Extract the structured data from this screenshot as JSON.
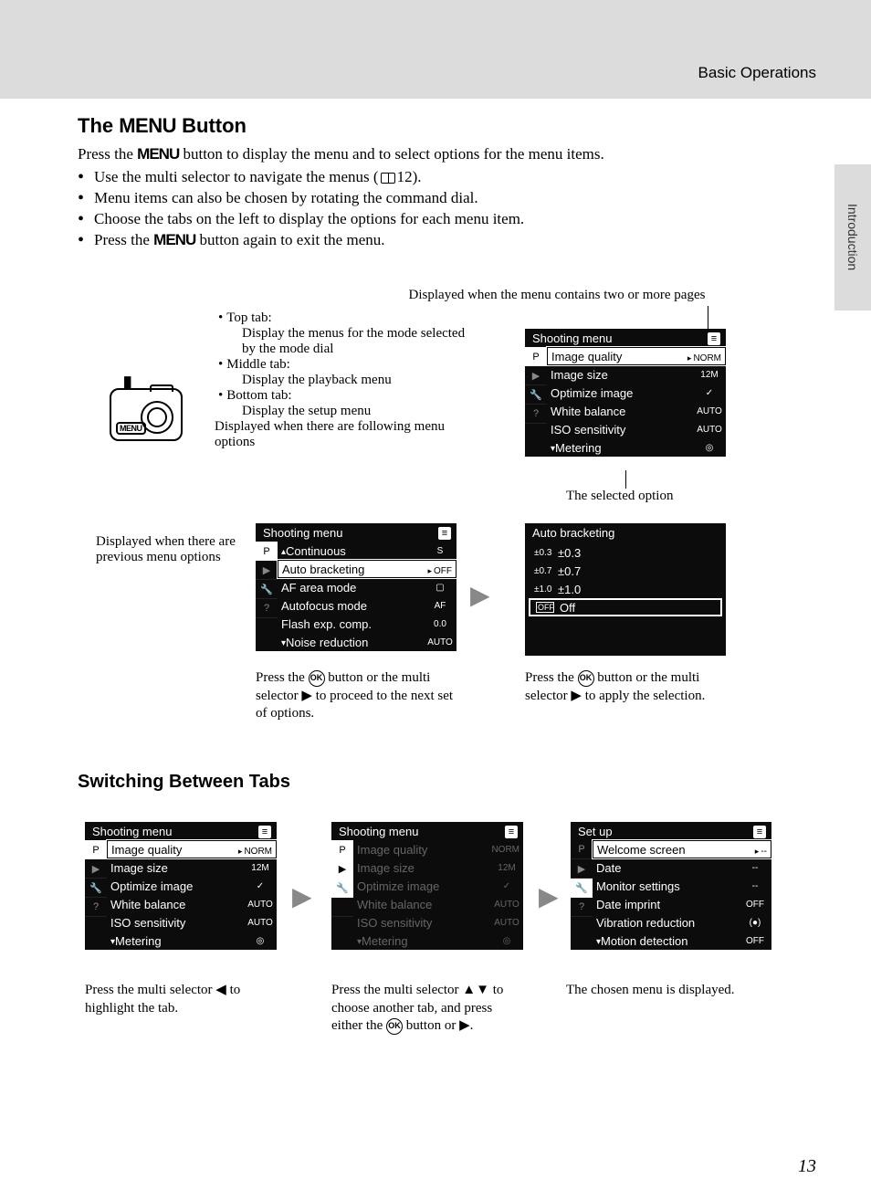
{
  "header": {
    "section": "Basic Operations",
    "side_tab": "Introduction"
  },
  "title_line": {
    "pre": "The ",
    "menu": "MENU",
    "post": " Button"
  },
  "intro": {
    "pre": "Press the ",
    "menu": "MENU",
    "post": " button to display the menu and to select options for the menu items."
  },
  "bullets": [
    "Use the multi selector to navigate the menus (📖12).",
    "Menu items can also be chosen by rotating the command dial.",
    "Choose the tabs on the left to display the options for each menu item.",
    "Press the MENU button again to exit the menu."
  ],
  "bullet4": {
    "pre": "Press the ",
    "menu": "MENU",
    "post": " button again to exit the menu."
  },
  "top_label": "Displayed when the menu contains two or more pages",
  "tabs_desc": {
    "top": {
      "label": "Top tab:",
      "text": "Display the menus for the mode selected by the mode dial"
    },
    "middle": {
      "label": "Middle tab:",
      "text": "Display the playback menu"
    },
    "bottom": {
      "label": "Bottom tab:",
      "text": "Display the setup menu"
    },
    "following": "Displayed when there are following menu options"
  },
  "camera": {
    "menu_label": "MENU"
  },
  "screen1": {
    "title": "Shooting menu",
    "items": [
      {
        "label": "Image quality",
        "value": "NORM",
        "selected": true
      },
      {
        "label": "Image size",
        "value": "12M"
      },
      {
        "label": "Optimize image",
        "value": "✓"
      },
      {
        "label": "White balance",
        "value": "AUTO"
      },
      {
        "label": "ISO sensitivity",
        "value": "AUTO"
      },
      {
        "label": "Metering",
        "value": "◎"
      }
    ]
  },
  "selected_label": "The selected option",
  "prev_label": "Displayed when there are previous menu options",
  "screen2": {
    "title": "Shooting menu",
    "items": [
      {
        "label": "Continuous",
        "value": "S"
      },
      {
        "label": "Auto bracketing",
        "value": "OFF",
        "selected": true
      },
      {
        "label": "AF area mode",
        "value": "▢"
      },
      {
        "label": "Autofocus mode",
        "value": "AF"
      },
      {
        "label": "Flash exp. comp.",
        "value": "0.0"
      },
      {
        "label": "Noise reduction",
        "value": "AUTO"
      }
    ]
  },
  "screen2_caption": "Press the ⊛ button or the multi selector ▶ to proceed to the next set of options.",
  "screen3": {
    "title": "Auto bracketing",
    "items": [
      {
        "icon": "±0.3",
        "label": "±0.3"
      },
      {
        "icon": "±0.7",
        "label": "±0.7"
      },
      {
        "icon": "±1.0",
        "label": "±1.0"
      },
      {
        "icon": "OFF",
        "label": "Off",
        "selected": true
      }
    ]
  },
  "screen3_caption": "Press the ⊛ button or the multi selector ▶ to apply the selection.",
  "h3": "Switching Between Tabs",
  "sw1": {
    "title": "Shooting menu",
    "items": [
      {
        "label": "Image quality",
        "value": "NORM",
        "selected": true
      },
      {
        "label": "Image size",
        "value": "12M"
      },
      {
        "label": "Optimize image",
        "value": "✓"
      },
      {
        "label": "White balance",
        "value": "AUTO"
      },
      {
        "label": "ISO sensitivity",
        "value": "AUTO"
      },
      {
        "label": "Metering",
        "value": "◎"
      }
    ],
    "caption": "Press the multi selector ◀ to highlight the tab."
  },
  "sw2": {
    "title": "Shooting menu",
    "items": [
      {
        "label": "Image quality",
        "value": "NORM"
      },
      {
        "label": "Image size",
        "value": "12M"
      },
      {
        "label": "Optimize image",
        "value": "✓"
      },
      {
        "label": "White balance",
        "value": "AUTO"
      },
      {
        "label": "ISO sensitivity",
        "value": "AUTO"
      },
      {
        "label": "Metering",
        "value": "◎"
      }
    ],
    "caption": "Press the multi selector ▲▼ to choose another tab, and press either the ⊛ button or ▶."
  },
  "sw3": {
    "title": "Set up",
    "items": [
      {
        "label": "Welcome screen",
        "value": "--",
        "selected": true
      },
      {
        "label": "Date",
        "value": "--"
      },
      {
        "label": "Monitor settings",
        "value": "--"
      },
      {
        "label": "Date imprint",
        "value": "OFF"
      },
      {
        "label": "Vibration reduction",
        "value": "(●)"
      },
      {
        "label": "Motion detection",
        "value": "OFF"
      }
    ],
    "caption": "The chosen menu is displayed."
  },
  "page_number": "13"
}
